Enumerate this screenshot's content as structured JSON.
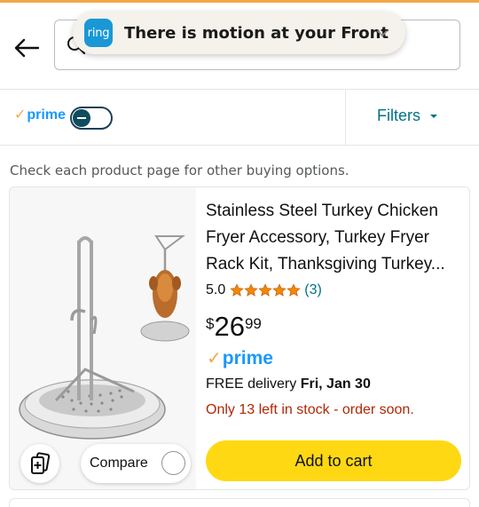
{
  "header": {
    "search_value": ""
  },
  "notification": {
    "app_logo_text": "ring",
    "message": "There is motion at your Front"
  },
  "filter_bar": {
    "prime_label": "prime",
    "prime_toggle_on": false,
    "filters_label": "Filters"
  },
  "notice": "Check each product page for other buying options.",
  "product": {
    "title_lines": [
      "Stainless Steel Turkey Chicken",
      "Fryer Accessory, Turkey Fryer",
      "Rack Kit, Thanksgiving Turkey..."
    ],
    "rating_value": "5.0",
    "rating_stars": 5,
    "review_count": "(3)",
    "price_symbol": "$",
    "price_whole": "26",
    "price_fraction": "99",
    "prime_label": "prime",
    "delivery_prefix": "FREE delivery ",
    "delivery_date": "Fri, Jan 30",
    "stock_message": "Only 13 left in stock - order soon.",
    "add_to_cart_label": "Add to cart",
    "compare_label": "Compare"
  },
  "colors": {
    "accent_orange": "#f3a847",
    "prime_blue": "#1a98ff",
    "link_teal": "#007185",
    "stock_red": "#b12704",
    "cart_yellow": "#ffd814",
    "ring_blue": "#1998d5",
    "star_orange": "#f08804"
  },
  "icons": {
    "back": "arrow-left-icon",
    "search": "search-icon",
    "notification_expand": "chevron-down-icon",
    "filters_caret": "caret-down-icon",
    "see_similar": "see-similar-icon",
    "star": "star-icon"
  }
}
